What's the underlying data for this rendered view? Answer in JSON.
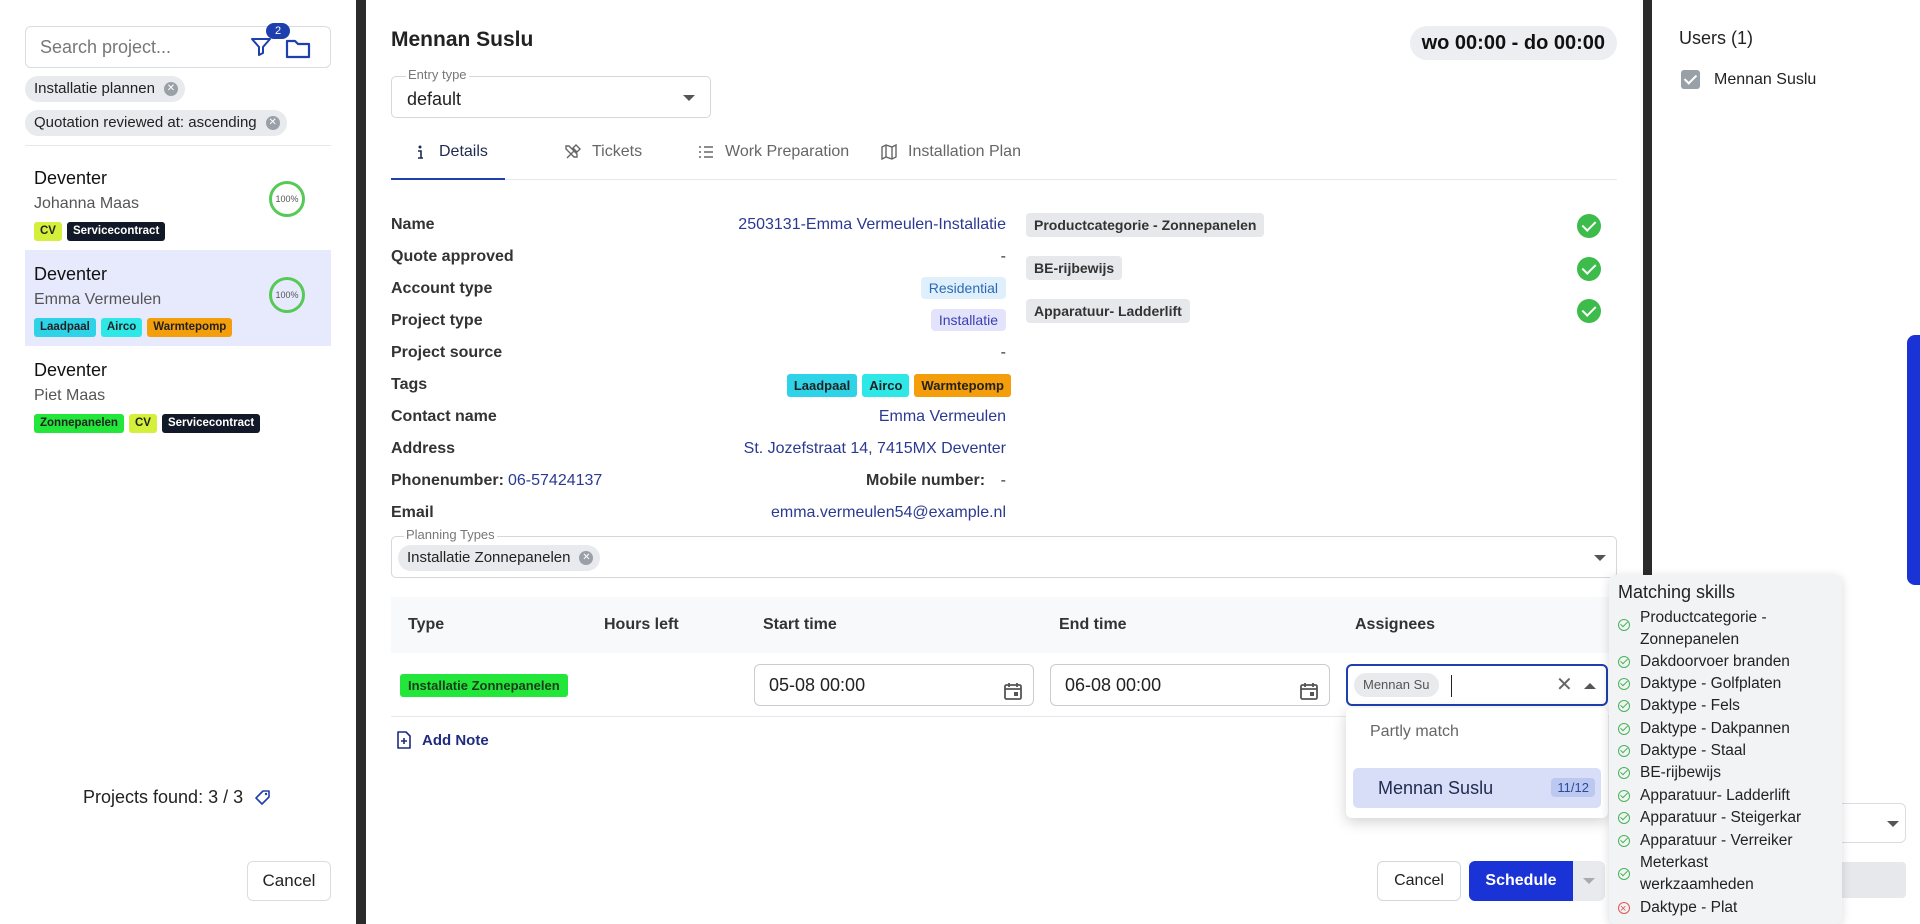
{
  "left": {
    "search_placeholder": "Search project...",
    "filter_count": "2",
    "chips": [
      "Installatie plannen",
      "Quotation reviewed at: ascending"
    ],
    "projects": [
      {
        "city": "Deventer",
        "person": "Johanna Maas",
        "progress": "100%",
        "tags": [
          "CV",
          "Servicecontract"
        ]
      },
      {
        "city": "Deventer",
        "person": "Emma Vermeulen",
        "progress": "100%",
        "tags": [
          "Laadpaal",
          "Airco",
          "Warmtepomp"
        ]
      },
      {
        "city": "Deventer",
        "person": "Piet Maas",
        "progress": "",
        "tags": [
          "Zonnepanelen",
          "CV",
          "Servicecontract"
        ]
      }
    ],
    "found": "Projects found: 3 / 3",
    "cancel": "Cancel"
  },
  "tag_colors": {
    "CV": "#d4f03a",
    "Servicecontract": "#111827",
    "Laadpaal": "#2ed3e8",
    "Airco": "#2ee8e8",
    "Warmtepomp": "#f59e0b",
    "Zonnepanelen": "#22e63a"
  },
  "modal": {
    "title": "Mennan Suslu",
    "time_range": "wo 00:00 - do 00:00",
    "entry_type_label": "Entry type",
    "entry_type_value": "default",
    "tabs": [
      "Details",
      "Tickets",
      "Work Preparation",
      "Installation Plan"
    ],
    "fields": {
      "name_label": "Name",
      "name_value": "2503131-Emma Vermeulen-Installatie",
      "quote_label": "Quote approved",
      "quote_value": "-",
      "account_label": "Account type",
      "account_value": "Residential",
      "ptype_label": "Project type",
      "ptype_value": "Installatie",
      "psource_label": "Project source",
      "psource_value": "-",
      "tags_label": "Tags",
      "tags": [
        "Laadpaal",
        "Airco",
        "Warmtepomp"
      ],
      "contact_label": "Contact name",
      "contact_value": "Emma Vermeulen",
      "address_label": "Address",
      "address_value": "St. Jozefstraat 14, 7415MX Deventer",
      "phone_label": "Phonenumber:",
      "phone_value": "06-57424137",
      "mobile_label": "Mobile number:",
      "mobile_value": "-",
      "email_label": "Email",
      "email_value": "emma.vermeulen54@example.nl"
    },
    "skills": [
      "Productcategorie - Zonnepanelen",
      "BE-rijbewijs",
      "Apparatuur- Ladderlift"
    ],
    "planning_types_label": "Planning Types",
    "planning_types_value": "Installatie Zonnepanelen",
    "table": {
      "headers": [
        "Type",
        "Hours left",
        "Start time",
        "End time",
        "Assignees"
      ],
      "type_tag": "Installatie Zonnepanelen",
      "start": "05-08 00:00",
      "end": "06-08 00:00",
      "assignee_chip": "Mennan Su"
    },
    "assign_dropdown": {
      "group": "Partly match",
      "option": "Mennan Suslu",
      "option_score": "11/12"
    },
    "add_note": "Add Note",
    "cancel": "Cancel",
    "schedule": "Schedule"
  },
  "right": {
    "users_title": "Users (1)",
    "user": "Mennan Suslu"
  },
  "skills_tip": {
    "title": "Matching skills",
    "items": [
      {
        "text": "Productcategorie - Zonnepanelen",
        "ok": true
      },
      {
        "text": "Dakdoorvoer branden",
        "ok": true
      },
      {
        "text": "Daktype - Golfplaten",
        "ok": true
      },
      {
        "text": "Daktype - Fels",
        "ok": true
      },
      {
        "text": "Daktype - Dakpannen",
        "ok": true
      },
      {
        "text": "Daktype - Staal",
        "ok": true
      },
      {
        "text": "BE-rijbewijs",
        "ok": true
      },
      {
        "text": "Apparatuur- Ladderlift",
        "ok": true
      },
      {
        "text": "Apparatuur - Steigerkar",
        "ok": true
      },
      {
        "text": "Apparatuur - Verreiker",
        "ok": true
      },
      {
        "text": "Meterkast werkzaamheden",
        "ok": true
      },
      {
        "text": "Daktype - Plat",
        "ok": false
      }
    ]
  }
}
